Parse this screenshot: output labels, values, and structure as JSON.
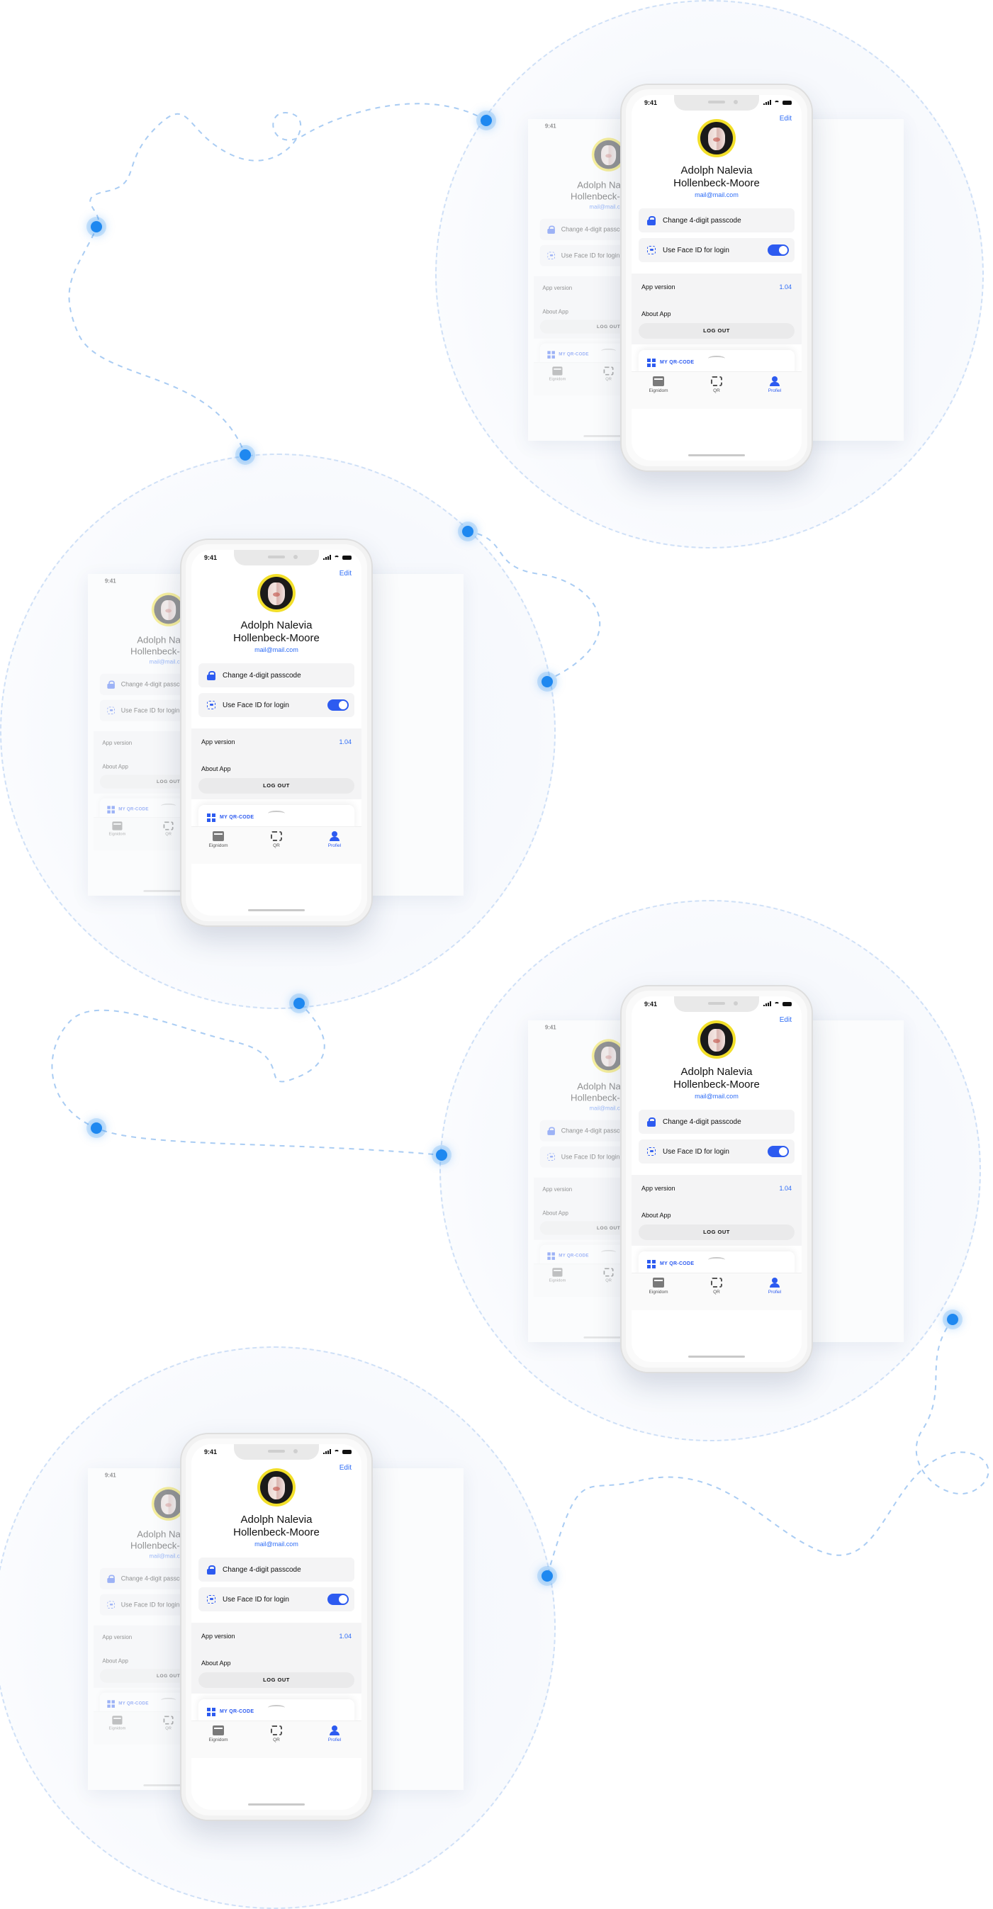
{
  "profile_screen": {
    "time": "9:41",
    "edit_label": "Edit",
    "name_line1": "Adolph Nalevia",
    "name_line2": "Hollenbeck-Moore",
    "email": "mail@mail.com",
    "change_passcode_label": "Change 4-digit passcode",
    "face_id_label": "Use Face ID for login",
    "face_id_enabled": true,
    "app_version_label": "App version",
    "app_version_value": "1.04",
    "about_app_label": "About App",
    "logout_label": "LOG OUT",
    "qr_code_label": "MY QR-CODE",
    "tabs": [
      {
        "label": "Eignidom",
        "icon": "wallet-icon",
        "active": false
      },
      {
        "label": "QR",
        "icon": "qr-scan-icon",
        "active": false
      },
      {
        "label": "Profiel",
        "icon": "user-icon",
        "active": true
      }
    ]
  },
  "colors": {
    "accent": "#2d5bf0",
    "link": "#2d6cf6",
    "dot": "#1e88f0",
    "avatar_ring": "#f2df2a"
  }
}
